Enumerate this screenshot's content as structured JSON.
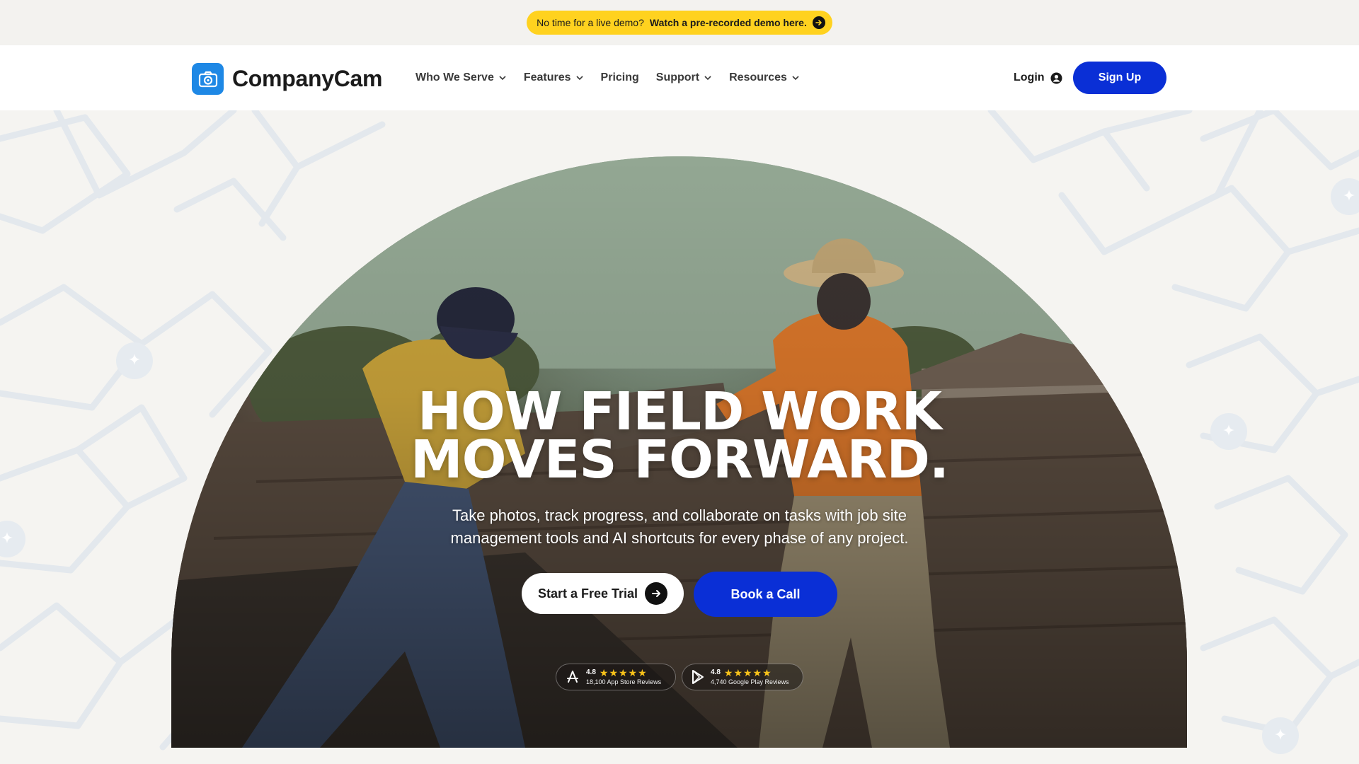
{
  "announcement": {
    "text": "No time for a live demo?",
    "link": "Watch a pre-recorded demo here."
  },
  "nav": {
    "brand": "CompanyCam",
    "items": [
      {
        "label": "Who We Serve"
      },
      {
        "label": "Features"
      },
      {
        "label": "Pricing"
      },
      {
        "label": "Support"
      },
      {
        "label": "Resources"
      }
    ],
    "login": "Login",
    "signup": "Sign Up"
  },
  "hero": {
    "headline_line1": "HOW FIELD WORK",
    "headline_line2": "MOVES FORWARD.",
    "subtitle_line1": "Take photos, track progress, and collaborate on tasks with job site",
    "subtitle_line2": "management tools and AI shortcuts for every phase of any project.",
    "cta_primary": "Start a Free Trial",
    "cta_secondary": "Book a Call"
  },
  "ratings": [
    {
      "store": "app-store",
      "score": "4.8",
      "stars": "★★★★★",
      "reviews": "18,100 App Store Reviews"
    },
    {
      "store": "google-play",
      "score": "4.8",
      "stars": "★★★★★",
      "reviews": "4,740 Google Play Reviews"
    }
  ],
  "colors": {
    "brand_blue": "#0a2fd6",
    "logo_blue": "#1e88e5",
    "announce_yellow": "#ffd21f"
  }
}
